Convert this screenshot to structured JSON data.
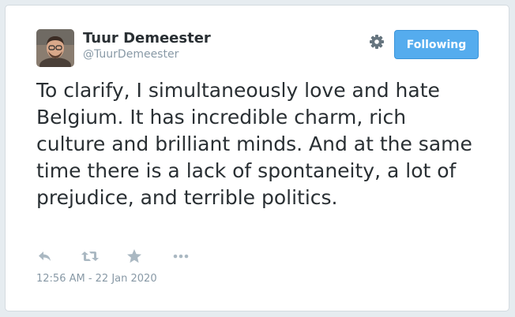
{
  "tweet": {
    "author": {
      "name": "Tuur Demeester",
      "handle": "@TuurDemeester"
    },
    "follow_button_label": "Following",
    "text": "To clarify, I simultaneously love and hate Belgium. It has incredible charm, rich culture and brilliant minds. And at the same time there is a lack of spontaneity, a lot of prejudice, and terrible politics.",
    "timestamp": "12:56 AM - 22 Jan 2020",
    "icons": {
      "settings": "gear-icon",
      "reply": "reply-icon",
      "retweet": "retweet-icon",
      "like": "star-icon",
      "more": "more-icon"
    }
  },
  "colors": {
    "accent": "#55acee",
    "text": "#292f33",
    "muted": "#8899a6",
    "icon": "#aab8c2"
  }
}
